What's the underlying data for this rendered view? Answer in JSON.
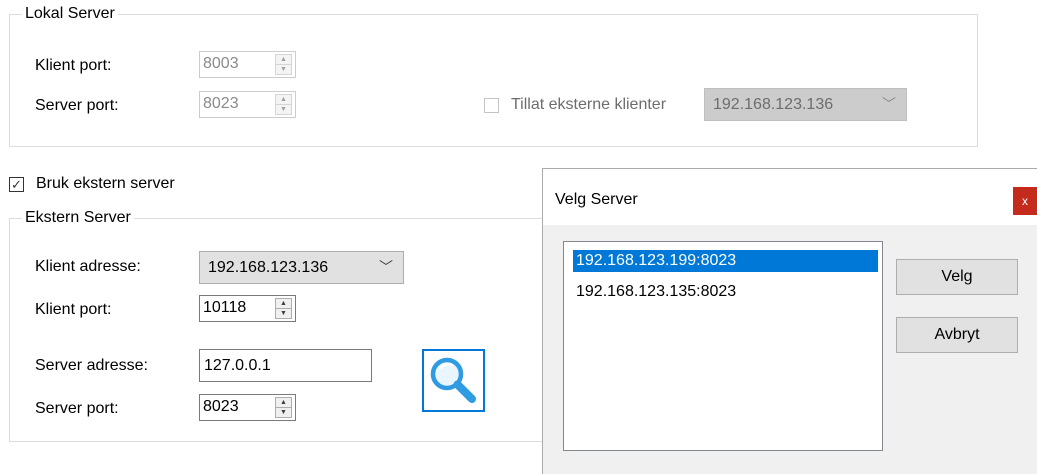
{
  "lokal_server": {
    "title": "Lokal Server",
    "klient_port_label": "Klient port:",
    "klient_port_value": "8003",
    "server_port_label": "Server port:",
    "server_port_value": "8023",
    "tillat_label": "Tillat eksterne klienter",
    "tillat_checked": false,
    "ip_value": "192.168.123.136"
  },
  "bruk_ekstern": {
    "label": "Bruk ekstern server",
    "checked": true,
    "check_glyph": "✓"
  },
  "ekstern_server": {
    "title": "Ekstern Server",
    "klient_adresse_label": "Klient adresse:",
    "klient_adresse_value": "192.168.123.136",
    "klient_port_label": "Klient port:",
    "klient_port_value": "10118",
    "server_adresse_label": "Server adresse:",
    "server_adresse_value": "127.0.0.1",
    "server_port_label": "Server port:",
    "server_port_value": "8023"
  },
  "glyphs": {
    "spin_up": "▲",
    "spin_down": "▼",
    "dropdown": "﹀"
  },
  "dialog": {
    "title": "Velg Server",
    "close_label": "x",
    "items": [
      "192.168.123.199:8023",
      "192.168.123.135:8023"
    ],
    "selected_index": 0,
    "velg_label": "Velg",
    "avbryt_label": "Avbryt"
  },
  "colors": {
    "accent": "#0078d7",
    "close_red": "#c42b1c",
    "dialog_bg": "#f0f0f0"
  },
  "icons": {
    "search": "search-icon",
    "close": "close-icon",
    "checkmark": "checkmark-icon",
    "dropdown": "chevron-down-icon"
  }
}
